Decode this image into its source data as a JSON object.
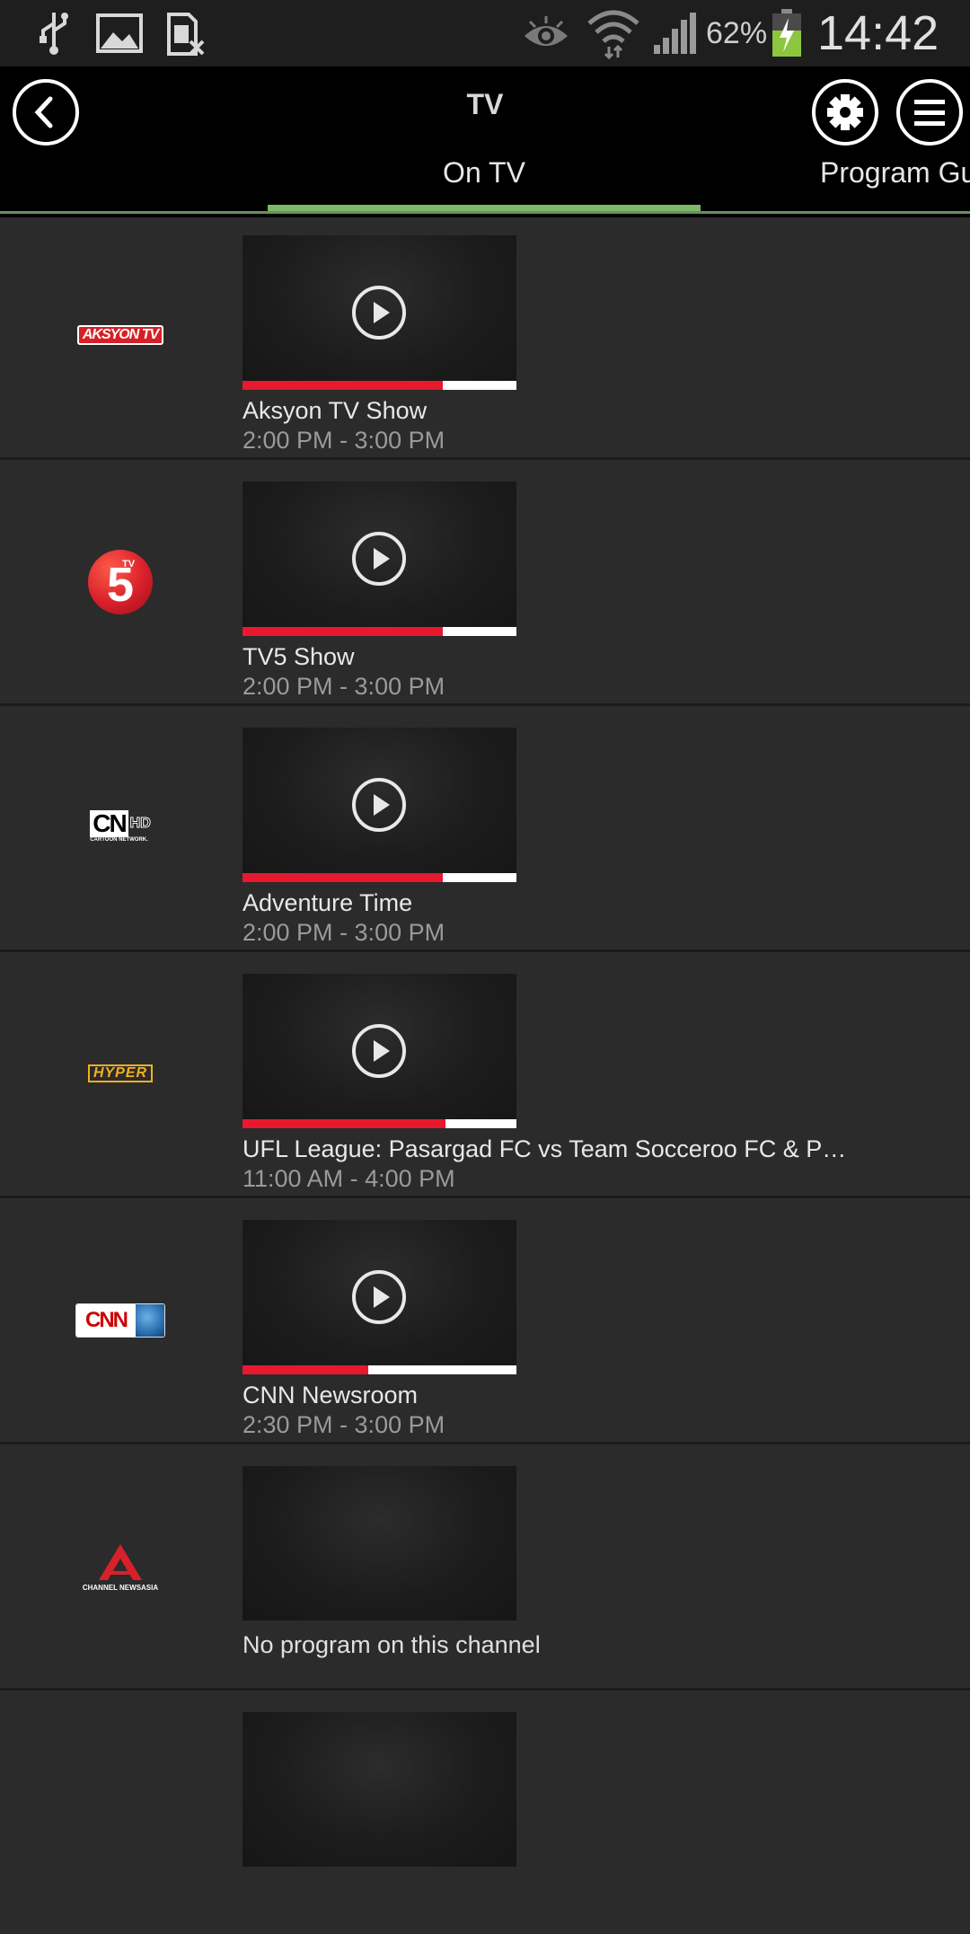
{
  "status_bar": {
    "icons": [
      "usb-icon",
      "gallery-icon",
      "no-sim-icon",
      "eye-icon",
      "wifi-icon",
      "signal-icon",
      "battery-charging-icon"
    ],
    "battery_percent": "62%",
    "time": "14:42"
  },
  "header": {
    "title": "TV",
    "back_icon": "back-arrow-icon",
    "settings_icon": "gear-icon",
    "menu_icon": "menu-icon",
    "tabs": [
      {
        "label": "On TV",
        "active": true
      },
      {
        "label": "Program Gu",
        "active": false
      }
    ]
  },
  "colors": {
    "accent_green": "#7fb86a",
    "progress_red": "#e8182e",
    "background": "#2b2b2b"
  },
  "channels": [
    {
      "logo_text": "AKSYON TV",
      "title": "Aksyon TV Show",
      "time": "2:00 PM - 3:00 PM",
      "progress": 0.73
    },
    {
      "logo_text": "5",
      "logo_sub": "TV",
      "title": "TV5 Show",
      "time": "2:00 PM - 3:00 PM",
      "progress": 0.73
    },
    {
      "logo_text": "CN",
      "logo_hd": "HD",
      "logo_sub": "CARTOON NETWORK.",
      "title": "Adventure Time",
      "time": "2:00 PM - 3:00 PM",
      "progress": 0.73
    },
    {
      "logo_text": "HYPER",
      "title": "UFL League: Pasargad FC vs Team Socceroo FC & P…",
      "time": "11:00 AM - 4:00 PM",
      "progress": 0.74
    },
    {
      "logo_text": "CNN",
      "title": "CNN Newsroom",
      "time": "2:30 PM - 3:00 PM",
      "progress": 0.46
    },
    {
      "logo_text": "CHANNEL NEWSASIA",
      "no_program": "No program on this channel"
    }
  ]
}
